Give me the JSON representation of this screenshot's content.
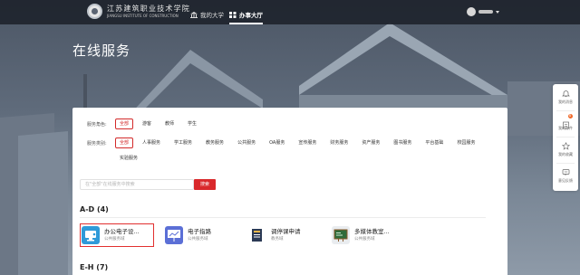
{
  "header": {
    "logo_cn": "江苏建筑职业技术学院",
    "logo_en": "JIANGSU INSTITUTE OF CONSTRUCTION",
    "nav": [
      {
        "label": "我的大学",
        "icon": "building-icon",
        "active": false
      },
      {
        "label": "办事大厅",
        "icon": "grid-icon",
        "active": true
      }
    ]
  },
  "page": {
    "title": "在线服务"
  },
  "filters": {
    "role": {
      "label": "服务角色:",
      "options": [
        "全部",
        "游客",
        "教师",
        "学生"
      ],
      "selected": "全部"
    },
    "category": {
      "label": "服务类别:",
      "options": [
        "全部",
        "人事服务",
        "学工服务",
        "教务服务",
        "公共服务",
        "OA服务",
        "宣传服务",
        "财务服务",
        "资产服务",
        "图书服务",
        "平台基础",
        "校园服务",
        "实验服务"
      ],
      "selected": "全部"
    }
  },
  "search": {
    "placeholder": "在\"全部\"在线服务中搜索",
    "button": "搜索"
  },
  "groups": [
    {
      "label": "A-D",
      "count": "(4)",
      "items": [
        {
          "name": "办公电子设...",
          "sub": "公共服务域",
          "icon": "office-device-icon",
          "highlighted": true
        },
        {
          "name": "电子指路",
          "sub": "公共服务域",
          "icon": "presentation-icon",
          "highlighted": false
        },
        {
          "name": "调停课申请",
          "sub": "教务域",
          "icon": "calendar-book-icon",
          "highlighted": false
        },
        {
          "name": "多媒体教室...",
          "sub": "公共服务域",
          "icon": "blackboard-icon",
          "highlighted": false
        }
      ]
    },
    {
      "label": "E-H",
      "count": "(7)",
      "items": []
    }
  ],
  "sidebar": [
    {
      "label": "我的消息",
      "icon": "bell-icon"
    },
    {
      "label": "我的办件",
      "icon": "task-icon",
      "badge": "8"
    },
    {
      "label": "我的收藏",
      "icon": "star-icon"
    },
    {
      "label": "意见反馈",
      "icon": "feedback-icon"
    }
  ],
  "colors": {
    "accent": "#d9282b",
    "nav_bg": "#1c212a",
    "highlight": "#e2302f"
  }
}
